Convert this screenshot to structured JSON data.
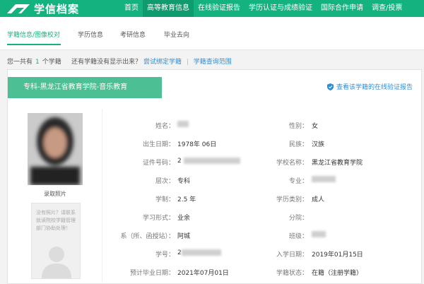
{
  "app": {
    "logo_text": "学信档案"
  },
  "top_nav": {
    "items": [
      {
        "label": "首页",
        "active": false
      },
      {
        "label": "高等教育信息",
        "active": true
      },
      {
        "label": "在线验证报告",
        "active": false
      },
      {
        "label": "学历认证与成绩验证",
        "active": false
      },
      {
        "label": "国际合作申请",
        "active": false
      },
      {
        "label": "调查/投票",
        "active": false
      }
    ]
  },
  "sub_nav": {
    "items": [
      {
        "label": "学籍信息/图像校对",
        "active": true
      },
      {
        "label": "学历信息",
        "active": false
      },
      {
        "label": "考研信息",
        "active": false
      },
      {
        "label": "毕业去向",
        "active": false
      }
    ]
  },
  "summary": {
    "prefix": "您一共有",
    "count": "1",
    "suffix": "个学籍",
    "question": "还有学籍没有显示出来？",
    "bind_link": "尝试绑定学籍",
    "separator": "|",
    "scope_link": "学籍查询范围"
  },
  "record": {
    "banner": "专科-黑龙江省教育学院-音乐教育",
    "verify_link": "查看该学籍的在线验证报告",
    "photo_caption": "录取照片",
    "no_photo_text": "没有照片？请联系就读院校学籍管理部门协助处理！",
    "fields_left": [
      {
        "label": "姓名：",
        "value": "",
        "redacted": true
      },
      {
        "label": "出生日期：",
        "value": "1978年  06日"
      },
      {
        "label": "证件号码：",
        "value": "2",
        "redacted": true
      },
      {
        "label": "层次：",
        "value": "专科"
      },
      {
        "label": "学制：",
        "value": "2.5 年"
      },
      {
        "label": "学习形式：",
        "value": "业余"
      },
      {
        "label": "系（所、函授站）：",
        "value": "阿城"
      },
      {
        "label": "学号：",
        "value": "2",
        "redacted": true
      },
      {
        "label": "预计毕业日期：",
        "value": "2021年07月01日"
      }
    ],
    "fields_right": [
      {
        "label": "性别：",
        "value": "女"
      },
      {
        "label": "民族：",
        "value": "汉族"
      },
      {
        "label": "学校名称：",
        "value": "黑龙江省教育学院"
      },
      {
        "label": "专业：",
        "value": "",
        "redacted": true
      },
      {
        "label": "学历类别：",
        "value": "成人"
      },
      {
        "label": "分院：",
        "value": ""
      },
      {
        "label": "班级：",
        "value": "",
        "redacted": true
      },
      {
        "label": "入学日期：",
        "value": "2019年01月15日"
      },
      {
        "label": "学籍状态：",
        "value": "在籍（注册学籍）"
      }
    ]
  },
  "colors": {
    "brand_green": "#14b27e",
    "banner_green": "#4cbf94",
    "link_blue": "#2b8fd8"
  }
}
